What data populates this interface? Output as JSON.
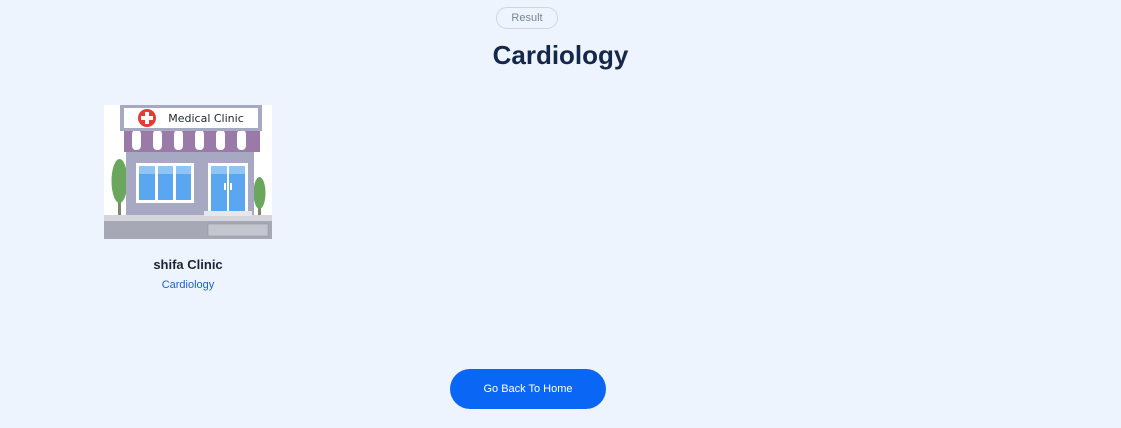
{
  "header": {
    "badge": "Result",
    "title": "Cardiology"
  },
  "results": [
    {
      "image_sign_text": "Medical Clinic",
      "name": "shifa Clinic",
      "specialty": "Cardiology"
    }
  ],
  "actions": {
    "home_label": "Go Back To Home"
  },
  "colors": {
    "background": "#edf4fe",
    "title": "#15274a",
    "accent": "#0a66f5",
    "link": "#1a63c9"
  }
}
